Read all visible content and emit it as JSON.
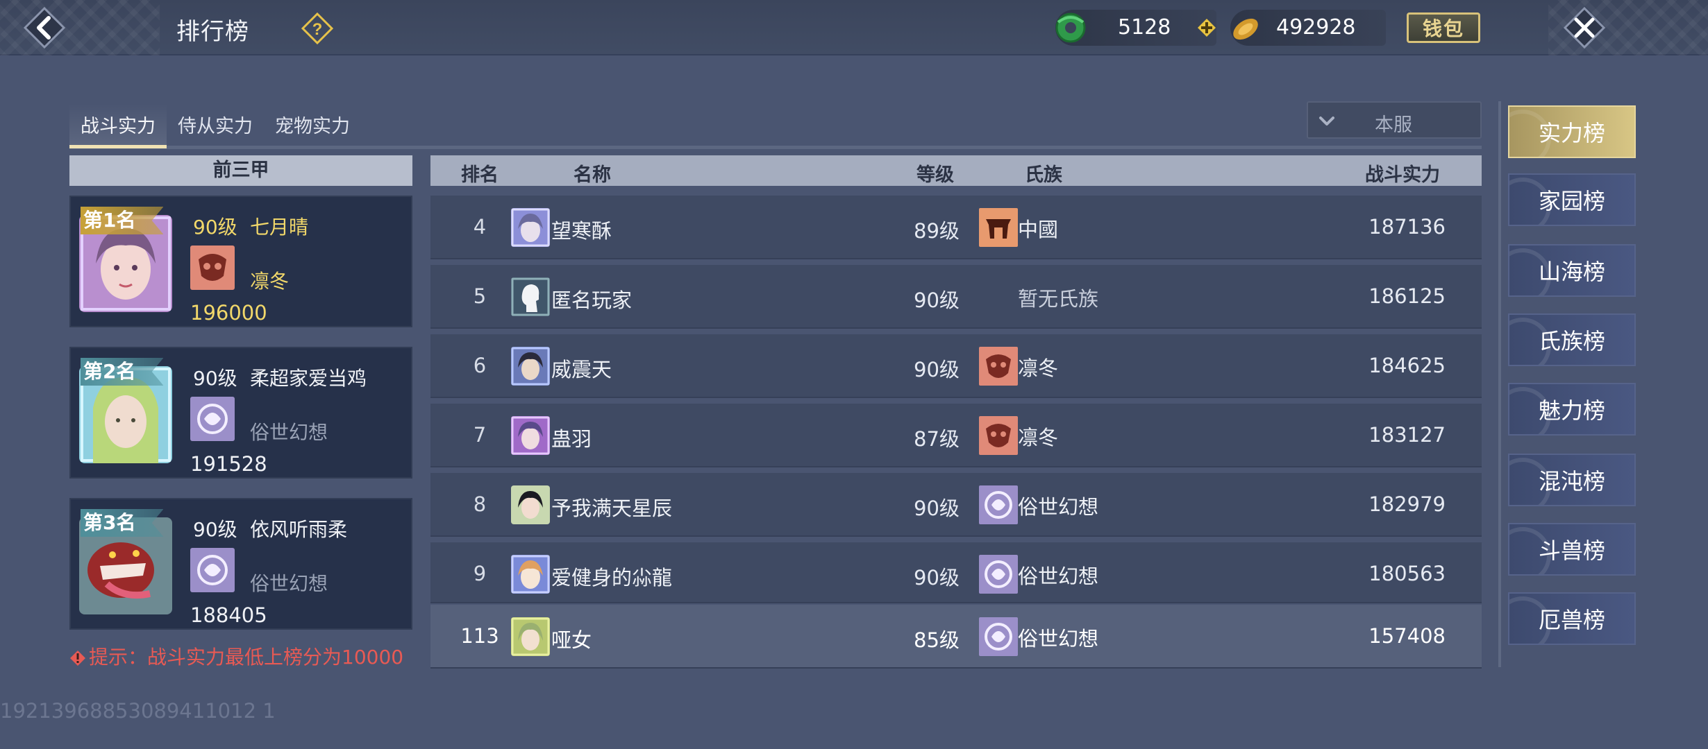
{
  "header": {
    "title": "排行榜",
    "jade_amount": "5128",
    "gold_amount": "492928",
    "wallet_label": "钱包",
    "icons": [
      "back-arrow-icon",
      "help-question-icon",
      "jade-coin-icon",
      "add-plus-icon",
      "gold-ingot-icon",
      "close-x-icon"
    ]
  },
  "tabs": [
    {
      "label": "战斗实力",
      "active": true
    },
    {
      "label": "侍从实力",
      "active": false
    },
    {
      "label": "宠物实力",
      "active": false
    }
  ],
  "server_select": {
    "value": "本服"
  },
  "top_three": {
    "header": "前三甲",
    "entries": [
      {
        "rank_label": "第1名",
        "level": "90级",
        "name": "七月晴",
        "clan": "凛冬",
        "power": "196000"
      },
      {
        "rank_label": "第2名",
        "level": "90级",
        "name": "柔超家爱当鸡",
        "clan": "俗世幻想",
        "power": "191528"
      },
      {
        "rank_label": "第3名",
        "level": "90级",
        "name": "依风听雨柔",
        "clan": "俗世幻想",
        "power": "188405"
      }
    ],
    "tip": "提示：战斗实力最低上榜分为10000"
  },
  "table": {
    "columns": {
      "rank": "排名",
      "name": "名称",
      "level": "等级",
      "clan": "氏族",
      "power": "战斗实力"
    },
    "rows": [
      {
        "rank": "4",
        "name": "望寒酥",
        "level": "89级",
        "clan": "中國",
        "power": "187136"
      },
      {
        "rank": "5",
        "name": "匿名玩家",
        "level": "90级",
        "clan": "暂无氏族",
        "power": "186125"
      },
      {
        "rank": "6",
        "name": "威震天",
        "level": "90级",
        "clan": "凛冬",
        "power": "184625"
      },
      {
        "rank": "7",
        "name": "蛊羽",
        "level": "87级",
        "clan": "凛冬",
        "power": "183127"
      },
      {
        "rank": "8",
        "name": "予我满天星辰",
        "level": "90级",
        "clan": "俗世幻想",
        "power": "182979"
      },
      {
        "rank": "9",
        "name": "爱健身的尛龍",
        "level": "90级",
        "clan": "俗世幻想",
        "power": "180563"
      }
    ],
    "self_row": {
      "rank": "113",
      "name": "哑女",
      "level": "85级",
      "clan": "俗世幻想",
      "power": "157408"
    }
  },
  "side_nav": [
    {
      "label": "实力榜",
      "active": true
    },
    {
      "label": "家园榜",
      "active": false
    },
    {
      "label": "山海榜",
      "active": false
    },
    {
      "label": "氏族榜",
      "active": false
    },
    {
      "label": "魅力榜",
      "active": false
    },
    {
      "label": "混沌榜",
      "active": false
    },
    {
      "label": "斗兽榜",
      "active": false
    },
    {
      "label": "厄兽榜",
      "active": false
    }
  ],
  "footer": {
    "id_text": "19213968853089411012 1"
  },
  "colors": {
    "active_gold": "#d8c685",
    "tip_red": "#e85a54",
    "top_gold_text": "#f2d86a"
  }
}
